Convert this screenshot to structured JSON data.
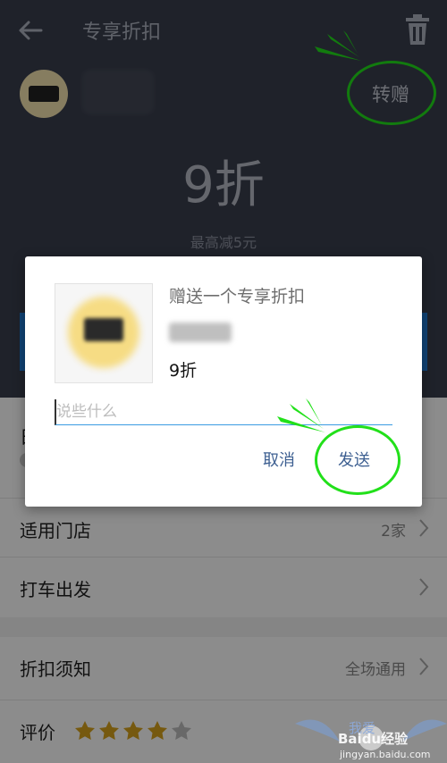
{
  "header": {
    "title": "专享折扣",
    "back_icon": "arrow-left-icon",
    "trash_icon": "trash-icon",
    "gift_label": "转赠",
    "discount": "9折",
    "max_reduction": "最高减5元"
  },
  "dialog": {
    "title": "赠送一个专享折扣",
    "discount": "9折",
    "message_placeholder": "说些什么",
    "cancel_label": "取消",
    "send_label": "发送"
  },
  "list": {
    "partial_label": "日",
    "stores": {
      "label": "适用门店",
      "value": "2家"
    },
    "taxi": {
      "label": "打车出发"
    },
    "notice": {
      "label": "折扣须知",
      "value": "全场通用"
    },
    "rating": {
      "label": "评价",
      "stars_filled": 4,
      "stars_total": 5
    }
  },
  "watermark": {
    "brand": "Baidu经验",
    "url": "jingyan.baidu.com",
    "slogan": "我爱"
  },
  "colors": {
    "annotation_green": "#22e01a",
    "header_bg": "#3a3f4e",
    "star": "#d8a21d",
    "link_blue": "#3d5f91"
  }
}
